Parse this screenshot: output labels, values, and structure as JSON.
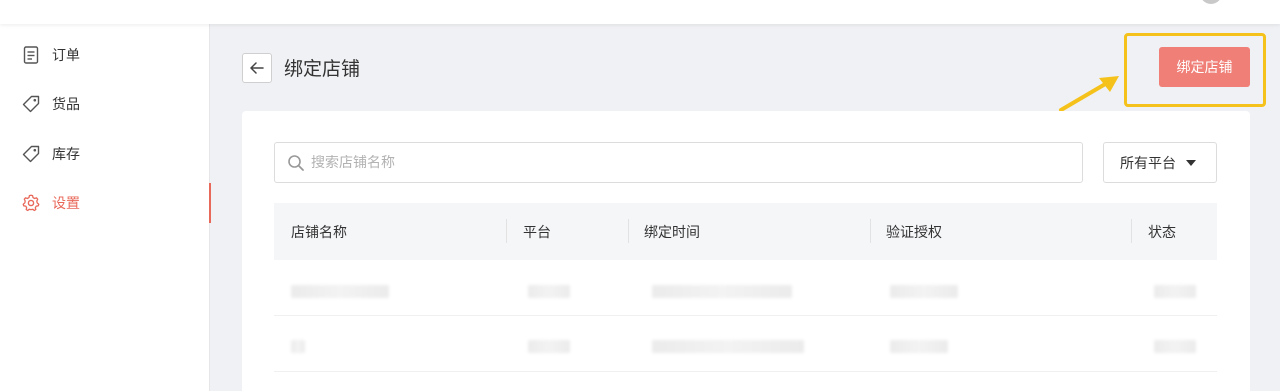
{
  "sidebar": {
    "items": [
      {
        "label": "订单",
        "icon": "document-icon",
        "active": false
      },
      {
        "label": "货品",
        "icon": "tag-icon",
        "active": false
      },
      {
        "label": "库存",
        "icon": "tag-icon",
        "active": false
      },
      {
        "label": "设置",
        "icon": "gear-icon",
        "active": true
      }
    ]
  },
  "header": {
    "title": "绑定店铺",
    "bind_button_label": "绑定店铺"
  },
  "search": {
    "placeholder": "搜索店铺名称",
    "value": ""
  },
  "platform_filter": {
    "selected": "所有平台"
  },
  "table": {
    "columns": [
      "店铺名称",
      "平台",
      "绑定时间",
      "验证授权",
      "状态"
    ]
  },
  "colors": {
    "accent": "#e8695a",
    "primary_button": "#ef7f77",
    "highlight": "#f5c21b"
  }
}
